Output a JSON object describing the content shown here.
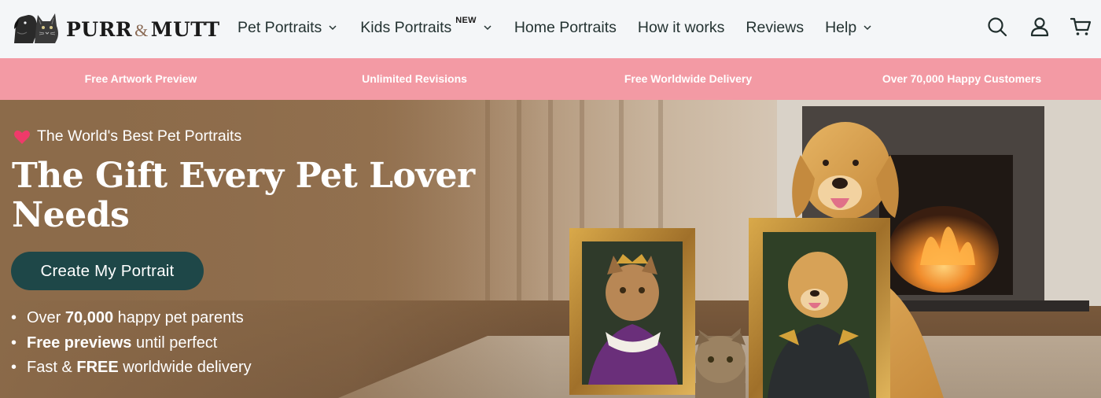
{
  "brand": {
    "logo_part1": "PURR",
    "logo_amp": "&",
    "logo_part2": "MUTT"
  },
  "nav": {
    "items": [
      {
        "label": "Pet Portraits",
        "has_dropdown": true
      },
      {
        "label": "Kids Portraits",
        "badge": "NEW",
        "has_dropdown": true
      },
      {
        "label": "Home Portraits",
        "has_dropdown": false
      },
      {
        "label": "How it works",
        "has_dropdown": false
      },
      {
        "label": "Reviews",
        "has_dropdown": false
      },
      {
        "label": "Help",
        "has_dropdown": true
      }
    ],
    "icons": [
      "search-icon",
      "account-icon",
      "cart-icon"
    ]
  },
  "promo_bar": {
    "background": "#f39aa4",
    "items": [
      "Free Artwork Preview",
      "Unlimited Revisions",
      "Free Worldwide Delivery",
      "Over 70,000 Happy Customers"
    ]
  },
  "hero": {
    "eyebrow": "The World's Best Pet Portraits",
    "eyebrow_icon": "heart-icon",
    "title": "The Gift Every Pet Lover Needs",
    "cta_label": "Create My Portrait",
    "cta_color": "#1e4748",
    "bullets": [
      {
        "pre": "Over ",
        "bold": "70,000",
        "post": " happy pet parents"
      },
      {
        "pre": "",
        "bold": "Free previews",
        "post": " until perfect"
      },
      {
        "pre": "Fast & ",
        "bold": "FREE",
        "post": " worldwide delivery"
      }
    ]
  }
}
